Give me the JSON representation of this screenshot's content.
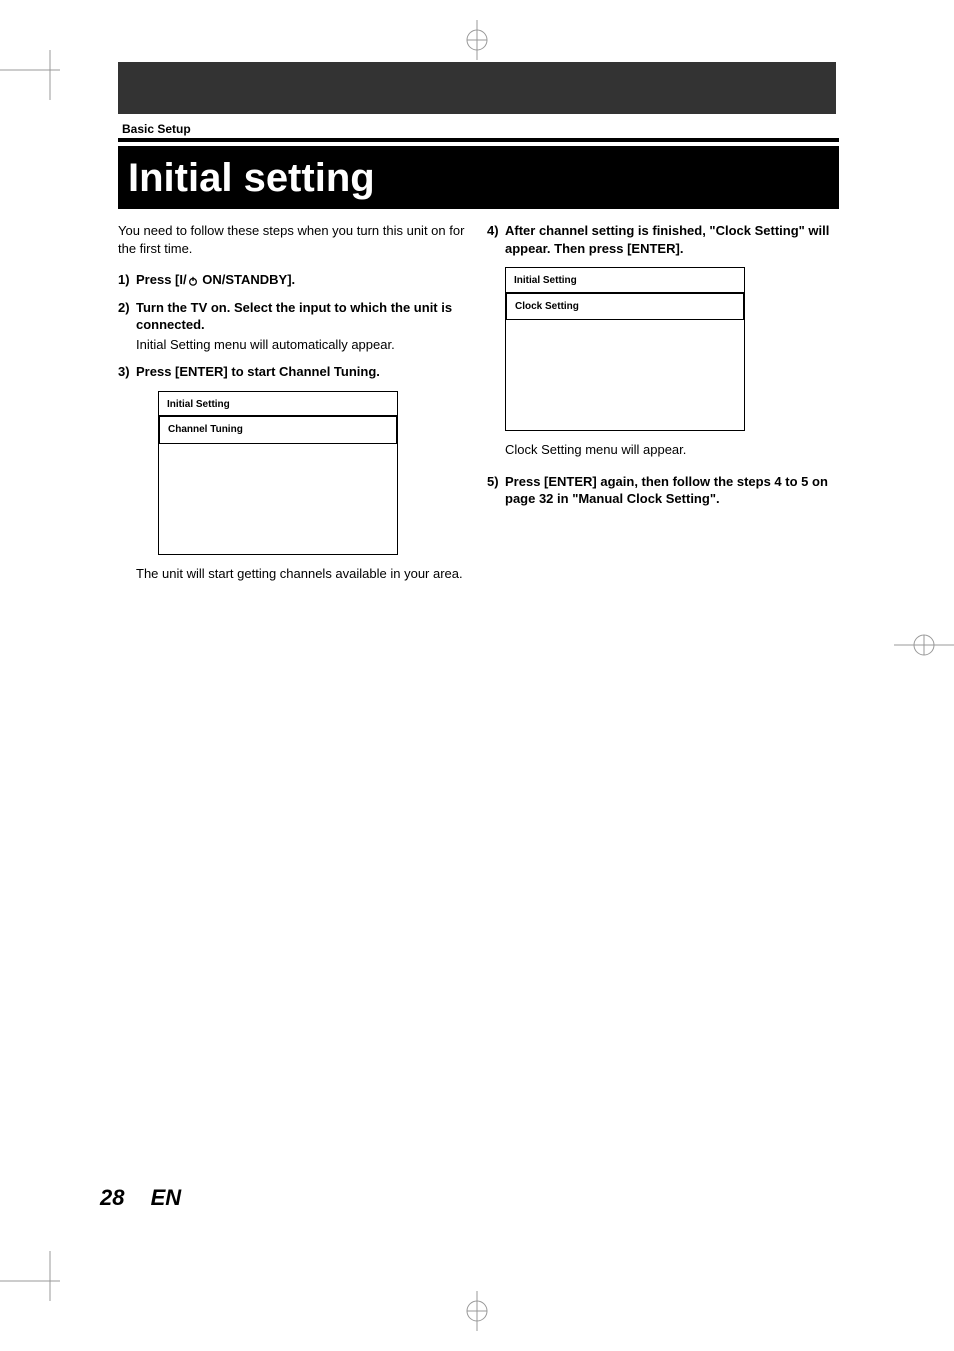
{
  "header": {
    "section_label": "Basic Setup",
    "title": "Initial setting"
  },
  "intro": "You need to follow these steps when you turn this unit on for the first time.",
  "steps_left": [
    {
      "num": "1)",
      "bold_prefix": "Press [I/",
      "bold_suffix": " ON/STANDBY]."
    },
    {
      "num": "2)",
      "bold": "Turn the TV on. Select the input to which the unit is connected.",
      "sub": "Initial Setting menu will automatically appear."
    },
    {
      "num": "3)",
      "bold": "Press [ENTER] to start Channel Tuning."
    }
  ],
  "screen1": {
    "title": "Initial Setting",
    "item": "Channel Tuning"
  },
  "after1": "The unit will start getting channels available in your area.",
  "steps_right": [
    {
      "num": "4)",
      "bold": "After channel setting is finished, \"Clock Setting\" will appear. Then press [ENTER]."
    }
  ],
  "screen2": {
    "title": "Initial Setting",
    "item": "Clock Setting"
  },
  "after2": "Clock Setting menu will appear.",
  "step5": {
    "num": "5)",
    "bold": "Press [ENTER] again, then follow the steps 4 to 5 on page 32 in \"Manual Clock Setting\"."
  },
  "footer": {
    "page": "28",
    "lang": "EN"
  }
}
